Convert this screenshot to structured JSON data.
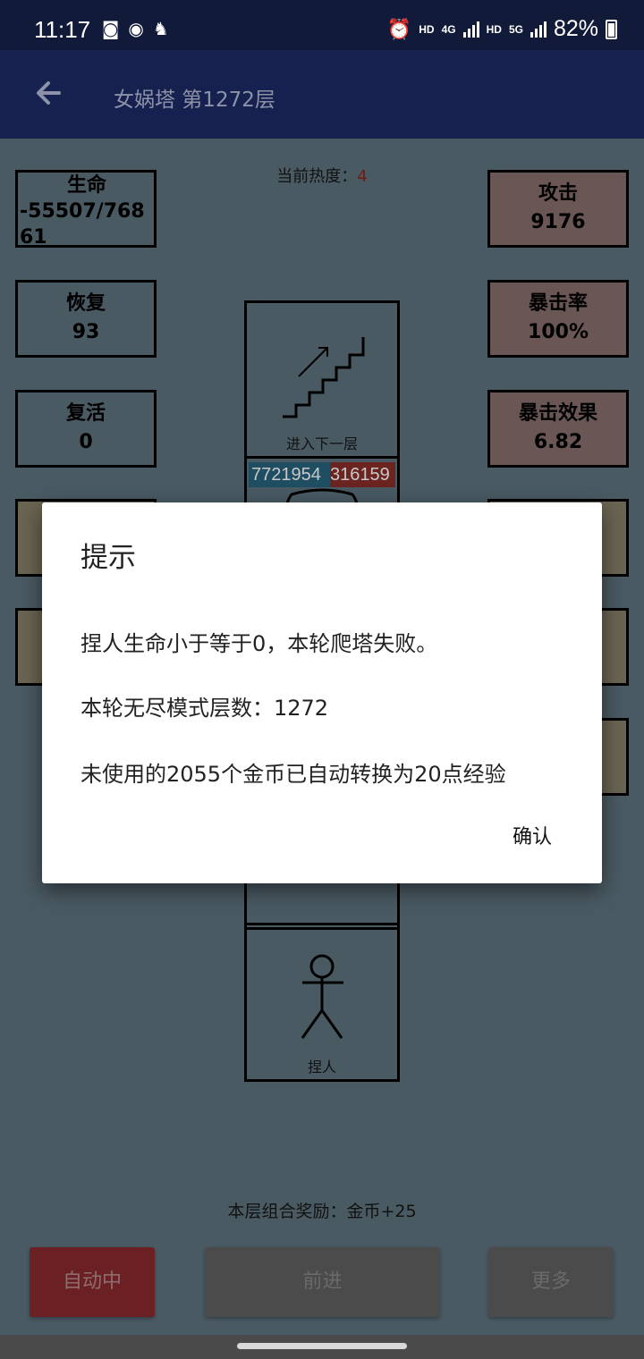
{
  "status_bar": {
    "time": "11:17",
    "net1": "HD",
    "net1_gen": "4G",
    "net2": "HD",
    "net2_gen": "5G",
    "battery": "82%"
  },
  "app_bar": {
    "title": "女娲塔 第1272层"
  },
  "board": {
    "heat_label": "当前热度：",
    "heat_value": "4",
    "stats_left": [
      {
        "label": "生命",
        "value": "-55507/76861"
      },
      {
        "label": "恢复",
        "value": "93"
      },
      {
        "label": "复活",
        "value": "0"
      }
    ],
    "stats_right": [
      {
        "label": "攻击",
        "value": "9176"
      },
      {
        "label": "暴击率",
        "value": "100%"
      },
      {
        "label": "暴击效果",
        "value": "6.82"
      }
    ],
    "stairs_label": "进入下一层",
    "enemy_hp_left": "7721954",
    "enemy_hp_right": "316159",
    "player_label": "捏人",
    "combo_reward": "本层组合奖励：金币+25"
  },
  "buttons": {
    "auto": "自动中",
    "forward": "前进",
    "more": "更多"
  },
  "dialog": {
    "title": "提示",
    "line1": "捏人生命小于等于0，本轮爬塔失败。",
    "line2": "本轮无尽模式层数：1272",
    "line3": "未使用的2055个金币已自动转换为20点经验",
    "confirm": "确认"
  }
}
